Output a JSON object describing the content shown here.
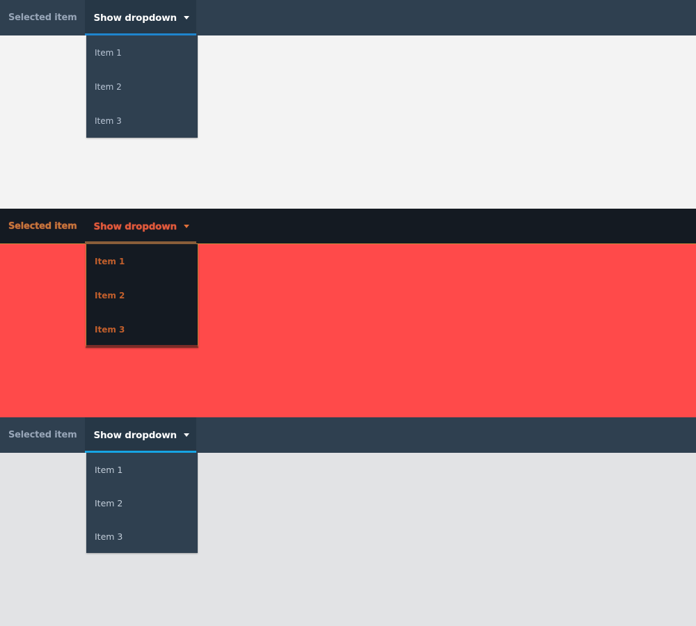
{
  "panels": [
    {
      "navbar": {
        "selected_label": "Selected item",
        "toggle_label": "Show dropdown"
      },
      "menu": {
        "items": [
          "Item 1",
          "Item 2",
          "Item 3"
        ]
      }
    },
    {
      "navbar": {
        "selected_label": "Selected item",
        "toggle_label": "Show dropdown"
      },
      "menu": {
        "items": [
          "Item 1",
          "Item 2",
          "Item 3"
        ]
      }
    },
    {
      "navbar": {
        "selected_label": "Selected item",
        "toggle_label": "Show dropdown"
      },
      "menu": {
        "items": [
          "Item 1",
          "Item 2",
          "Item 3"
        ]
      }
    }
  ],
  "colors": {
    "navbar": "#2f4050",
    "panel1_bg": "#f3f3f3",
    "panel2_bg": "#ff4a4a",
    "panel2_navbar": "#141a22",
    "panel3_bg": "#e2e3e5",
    "accent_blue": "#1f86cf",
    "accent_light_blue": "#17a5e4"
  },
  "icons": {
    "caret": "caret-down-icon"
  }
}
